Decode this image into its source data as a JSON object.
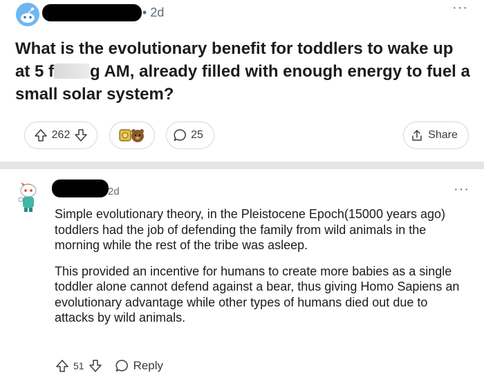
{
  "post": {
    "time": "2d",
    "title_part1": "What is the evolutionary benefit for toddlers to wake up at 5 f",
    "title_part2": "g AM, already filled with enough energy to fuel a small solar system?",
    "upvotes": "262",
    "comments": "25",
    "share_label": "Share"
  },
  "comment": {
    "time": "2d",
    "paragraphs": [
      "Simple evolutionary theory, in the Pleistocene Epoch(15000 years ago) toddlers had the job of defending the family from wild animals in the morning while the rest of the tribe was asleep.",
      "This provided an incentive for humans to create more babies as a single toddler alone cannot defend against a bear, thus giving Homo Sapiens an evolutionary advantage while other types of humans died out due to attacks by wild animals."
    ],
    "upvotes": "51",
    "reply_label": "Reply"
  },
  "icons": {
    "post_avatar": "snoo-avatar-icon",
    "comment_avatar": "snoo-avatar-icon",
    "upvote": "arrow-up-icon",
    "downvote": "arrow-down-icon",
    "comments": "speech-bubble-icon",
    "share": "share-icon",
    "more": "ellipsis-icon"
  },
  "colors": {
    "meta_text": "#576f76",
    "divider": "#e5e5e5",
    "pill_border": "#d6d6d6"
  }
}
